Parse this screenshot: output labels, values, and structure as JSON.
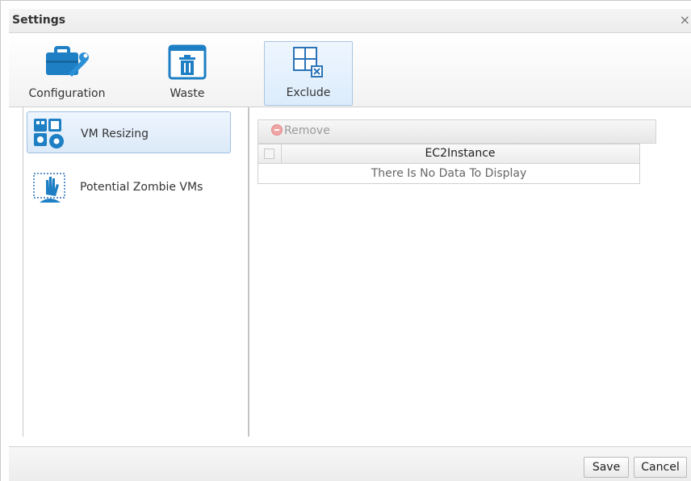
{
  "dialog": {
    "title": "Settings",
    "close_glyph": "×"
  },
  "toolbar": {
    "items": [
      {
        "label": "Configuration",
        "icon": "briefcase-wrench-icon"
      },
      {
        "label": "Waste",
        "icon": "trash-icon"
      },
      {
        "label": "Exclude",
        "icon": "exclude-grid-icon",
        "selected": true
      }
    ]
  },
  "sidebar": {
    "items": [
      {
        "label": "VM Resizing",
        "icon": "vm-resizing-icon",
        "selected": true
      },
      {
        "label": "Potential Zombie VMs",
        "icon": "zombie-hand-icon",
        "selected": false
      }
    ]
  },
  "grid": {
    "toolbar_remove_label": "Remove",
    "columns": [
      "EC2Instance"
    ],
    "empty_text": "There Is No Data To Display"
  },
  "footer": {
    "save_label": "Save",
    "cancel_label": "Cancel"
  },
  "colors": {
    "accent": "#2a73b8",
    "selected_bg": "#dce9f7",
    "icon_blue": "#1e7fc4"
  }
}
